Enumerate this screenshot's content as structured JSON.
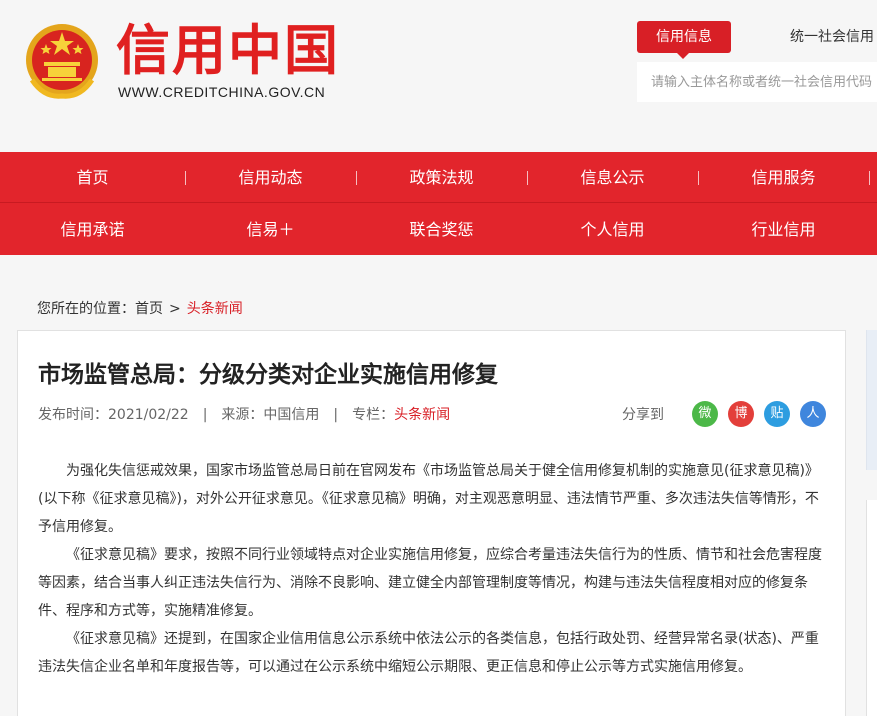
{
  "header": {
    "brand_title": "信用中国",
    "brand_url": "WWW.CREDITCHINA.GOV.CN",
    "search_tabs": [
      "信用信息",
      "统一社会信用"
    ],
    "search_placeholder": "请输入主体名称或者统一社会信用代码"
  },
  "nav": {
    "row1": [
      "首页",
      "信用动态",
      "政策法规",
      "信息公示",
      "信用服务"
    ],
    "row2": [
      "信用承诺",
      "信易＋",
      "联合奖惩",
      "个人信用",
      "行业信用"
    ]
  },
  "breadcrumb": {
    "prefix": "您所在的位置：",
    "home": "首页",
    "separator": ">",
    "current": "头条新闻"
  },
  "article": {
    "title": "市场监管总局：分级分类对企业实施信用修复",
    "publish_time": "发布时间：2021/02/22",
    "source": "来源：中国信用",
    "column_label": "专栏：",
    "column_value": "头条新闻",
    "share_label": "分享到",
    "share_icons": {
      "wechat": "微",
      "weibo": "博",
      "tieba": "贴",
      "renren": "人"
    },
    "paragraphs": [
      "为强化失信惩戒效果，国家市场监管总局日前在官网发布《市场监管总局关于健全信用修复机制的实施意见(征求意见稿)》(以下称《征求意见稿》)，对外公开征求意见。《征求意见稿》明确，对主观恶意明显、违法情节严重、多次违法失信等情形，不予信用修复。",
      "《征求意见稿》要求，按照不同行业领域特点对企业实施信用修复，应综合考量违法失信行为的性质、情节和社会危害程度等因素，结合当事人纠正违法失信行为、消除不良影响、建立健全内部管理制度等情况，构建与违法失信程度相对应的修复条件、程序和方式等，实施精准修复。",
      "《征求意见稿》还提到，在国家企业信用信息公示系统中依法公示的各类信息，包括行政处罚、经营异常名录(状态)、严重违法失信企业名单和年度报告等，可以通过在公示系统中缩短公示期限、更正信息和停止公示等方式实施信用修复。"
    ]
  },
  "colors": {
    "brand_red": "#e2252c",
    "link_red": "#d81f26",
    "wechat_green": "#4cb848",
    "weibo_red": "#e33f3a",
    "tieba_blue": "#2d9de0",
    "renren_blue": "#3f86dd"
  }
}
